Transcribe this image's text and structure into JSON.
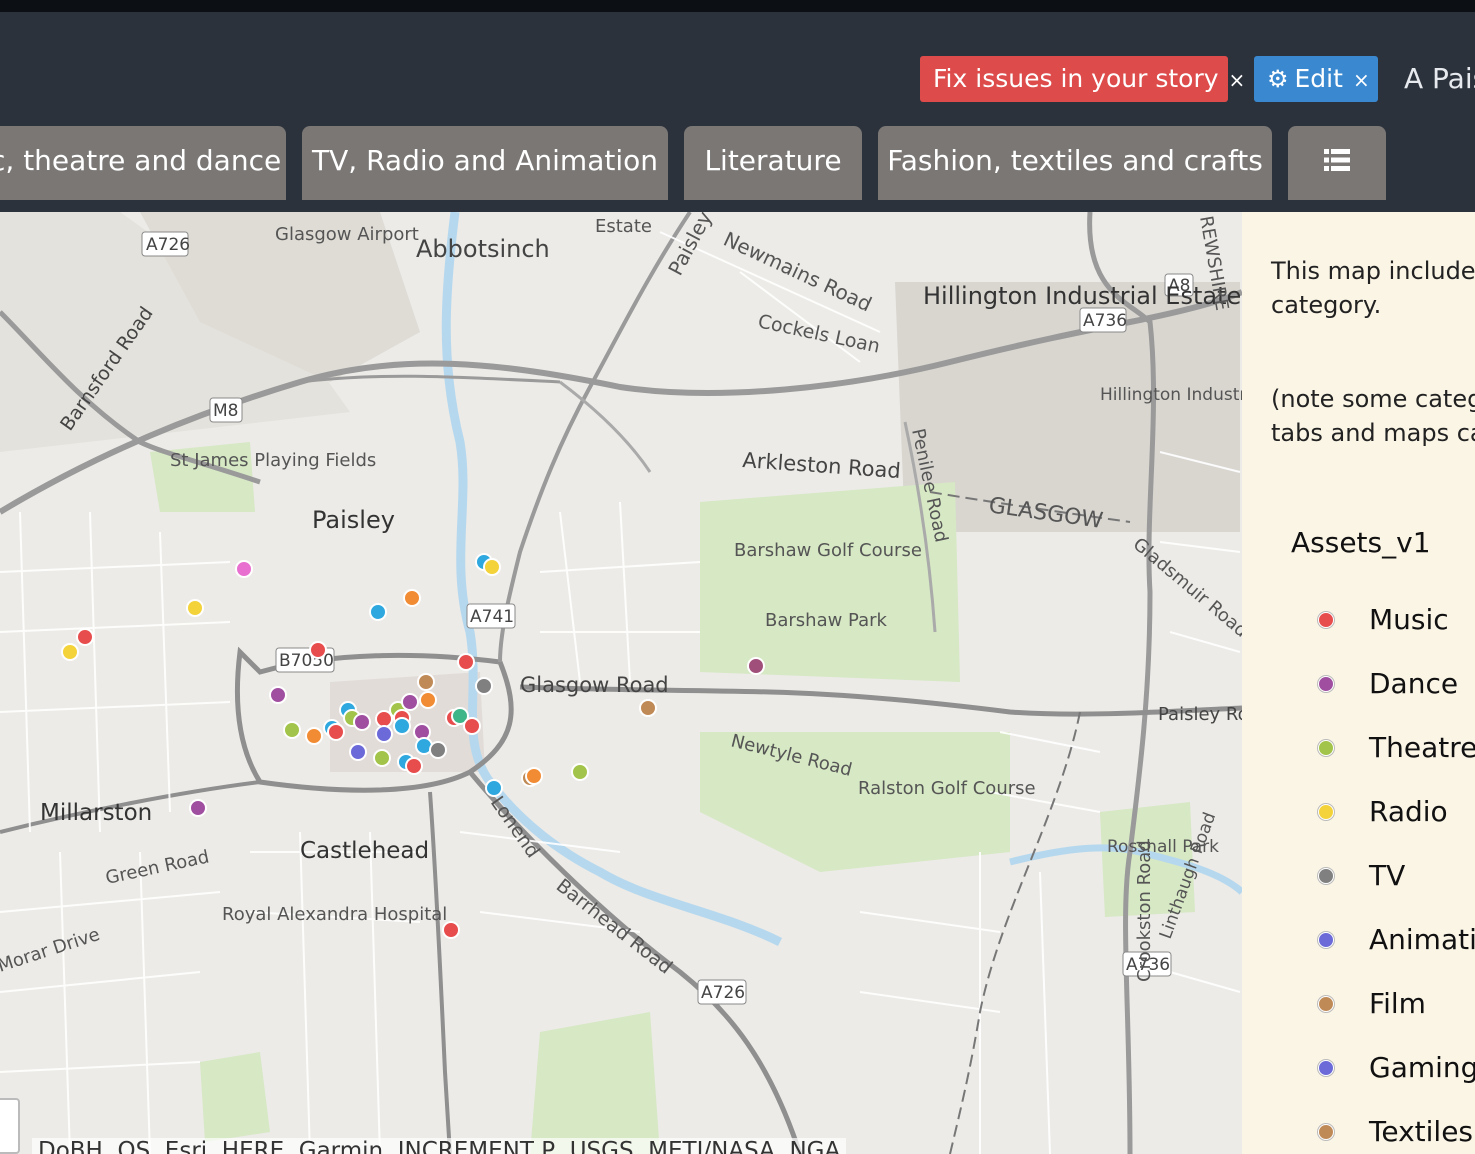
{
  "header": {
    "fix_button": {
      "label": "Fix issues in your story",
      "close": "×"
    },
    "edit_button": {
      "label": "Edit",
      "close": "×",
      "icon": "gear-icon"
    },
    "story_title": "A Pais"
  },
  "tabs": [
    {
      "label": "c, theatre and dance"
    },
    {
      "label": "TV, Radio and Animation"
    },
    {
      "label": "Literature"
    },
    {
      "label": "Fashion, textiles and crafts"
    },
    {
      "label": "",
      "icon": "list-icon"
    }
  ],
  "map": {
    "labels": {
      "glasgow_airport": "Glasgow Airport",
      "abbotsinch": "Abbotsinch",
      "estate": "Estate",
      "paisley_road_n": "Paisley",
      "newmains": "Newmains Road",
      "hillington_ind": "Hillington Industrial Estate",
      "cockels": "Cockels Loan",
      "hillington_ind_small": "Hillington Industrial Estate",
      "renfrewshire": "REWSHIRE",
      "arkleston": "Arkleston Road",
      "penilee": "Penilee Road",
      "glasgow": "GLASGOW",
      "st_james": "St James Playing Fields",
      "paisley": "Paisley",
      "barsahw_golf": "Barshaw Golf Course",
      "barshaw_park": "Barshaw Park",
      "gladsmuir": "Gladsmuir Road",
      "glasgow_road": "Glasgow Road",
      "paisley_road_west": "Paisley Road West",
      "newtyle": "Newtyle Road",
      "ralston": "Ralston Golf Course",
      "millarston": "Millarston",
      "castlehead": "Castlehead",
      "green_road": "Green Road",
      "royal_alex": "Royal Alexandra Hospital",
      "morar": "Morar Drive",
      "lonend": "Lonend",
      "barrhead": "Barrhead Road",
      "rosshall": "Rosshall Park",
      "linthaugh": "Linthaugh Road",
      "crookston": "Crookston Road",
      "barnsford": "Barnsford Road",
      "shields": "A726",
      "a726_top": "A726",
      "a8": "A8",
      "a736": "A736",
      "m8": "M8",
      "a741": "A741",
      "b7050": "B7050",
      "a726_bottom": "A726",
      "a736_bottom": "A736"
    },
    "attribution": "DoBH, OS, Esri, HERE, Garmin, INCREMENT P, USGS, METI/NASA, NGA"
  },
  "panel": {
    "intro_line1": "This map includes",
    "intro_line2": "category.",
    "note_line1": "(note some catego",
    "note_line2": "tabs and maps ca",
    "legend_title": "Assets_v1",
    "legend": [
      {
        "label": "Music",
        "color": "#e84d4d"
      },
      {
        "label": "Dance",
        "color": "#a04fa0"
      },
      {
        "label": "Theatre",
        "color": "#a3c44a"
      },
      {
        "label": "Radio",
        "color": "#f3d23a"
      },
      {
        "label": "TV",
        "color": "#808080"
      },
      {
        "label": "Animatic",
        "color": "#6c6ad8"
      },
      {
        "label": "Film",
        "color": "#c08a57"
      },
      {
        "label": "Gaming",
        "color": "#6c6ad8"
      },
      {
        "label": "Textiles",
        "color": "#c08a57"
      }
    ]
  },
  "colors": {
    "header_bg": "#2c323c",
    "fix_red": "#dd4b4b",
    "edit_blue": "#3a88d0",
    "tab_bg": "#7a7775",
    "panel_bg": "#fbf5e6"
  }
}
